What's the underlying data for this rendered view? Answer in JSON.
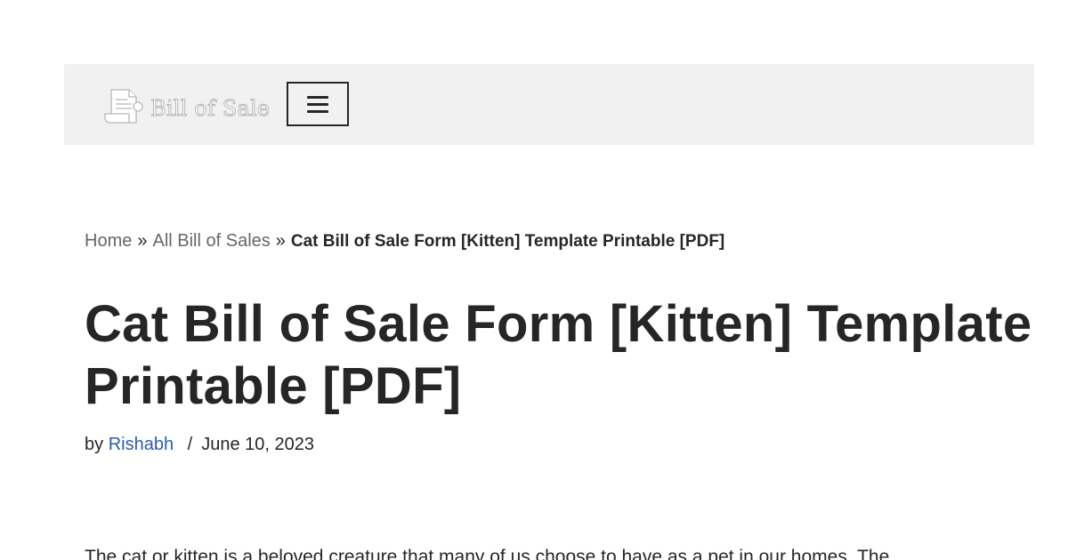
{
  "header": {
    "logo_text": "Bill of Sale",
    "logo_icon": "document-scroll-icon",
    "menu_icon": "hamburger-menu-icon"
  },
  "breadcrumb": {
    "home": "Home",
    "separator": "»",
    "category": "All Bill of Sales",
    "current": "Cat Bill of Sale Form [Kitten] Template Printable [PDF]"
  },
  "article": {
    "title": "Cat Bill of Sale Form [Kitten] Template Printable [PDF]",
    "by_label": "by",
    "author": "Rishabh",
    "meta_separator": "/",
    "date": "June 10, 2023",
    "intro": "The cat or kitten is a beloved creature that many of us choose to have as a pet in our homes. The"
  },
  "colors": {
    "header_background": "#f1f1f1",
    "text": "#272626",
    "breadcrumb_link": "#676767",
    "author_link": "#2f5aae"
  }
}
